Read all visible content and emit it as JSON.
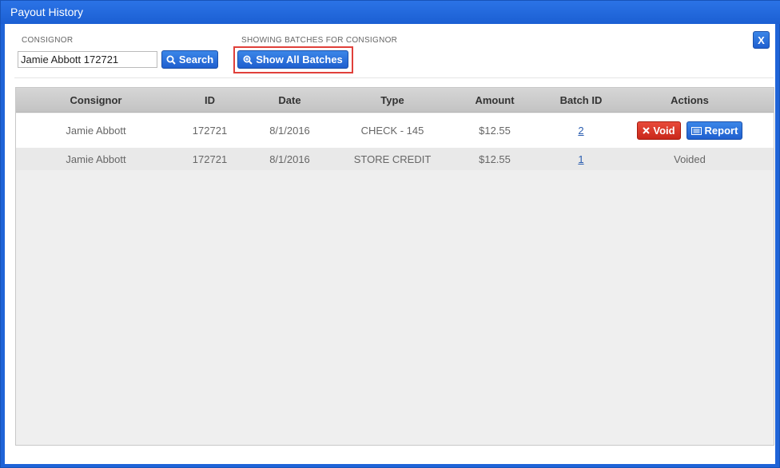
{
  "window": {
    "title": "Payout History"
  },
  "filters": {
    "consignor_label": "CONSIGNOR",
    "consignor_value": "Jamie Abbott 172721",
    "search_label": "Search",
    "showing_label": "SHOWING BATCHES FOR CONSIGNOR",
    "show_all_label": "Show All Batches"
  },
  "close_label": "X",
  "table": {
    "columns": [
      "Consignor",
      "ID",
      "Date",
      "Type",
      "Amount",
      "Batch ID",
      "Actions"
    ],
    "rows": [
      {
        "consignor": "Jamie Abbott",
        "id": "172721",
        "date": "8/1/2016",
        "type": "CHECK - 145",
        "amount": "$12.55",
        "batch_id": "2",
        "void_label": "Void",
        "report_label": "Report"
      },
      {
        "consignor": "Jamie Abbott",
        "id": "172721",
        "date": "8/1/2016",
        "type": "STORE CREDIT",
        "amount": "$12.55",
        "batch_id": "1",
        "status": "Voided"
      }
    ]
  },
  "colors": {
    "titlebar": "#1f64d8",
    "primary_button": "#1f5fcf",
    "danger_button": "#c9281a",
    "highlight": "#e0403a"
  },
  "icons": {
    "search": "search-icon",
    "show_all": "zoom-in-icon",
    "void": "x-icon",
    "report": "report-icon"
  }
}
